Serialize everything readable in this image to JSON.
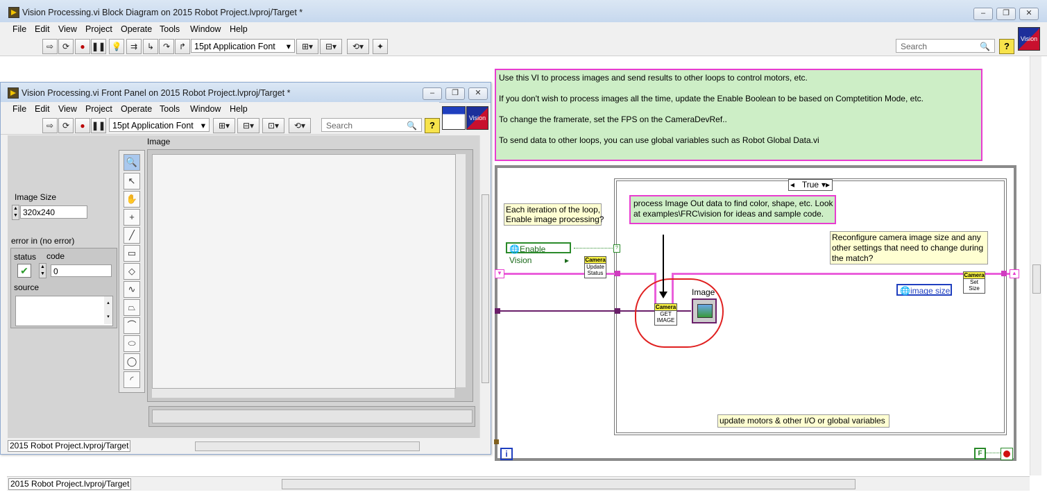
{
  "block_diagram": {
    "title": "Vision Processing.vi Block Diagram on 2015 Robot Project.lvproj/Target *",
    "menu": [
      "File",
      "Edit",
      "View",
      "Project",
      "Operate",
      "Tools",
      "Window",
      "Help"
    ],
    "font_select": "15pt Application Font",
    "search_placeholder": "Search",
    "help_icon": "?",
    "vision_badge": "Vision",
    "status_bar": "2015 Robot Project.lvproj/Target",
    "comment_lines": [
      "Use this VI to process images and send results to other loops to control motors, etc.",
      "If you don't wish to process images all the time, update the Enable Boolean to be based on Comptetition Mode, etc.",
      "To change the framerate, set the FPS on the CameraDevRef..",
      "To send data to other loops, you can use global variables such as Robot Global Data.vi"
    ],
    "case_selector": "True",
    "loop_note": [
      "Each iteration of the loop,",
      "Enable image processing?"
    ],
    "process_note": [
      "process Image Out data to find color, shape, etc.  Look",
      "at examples\\FRC\\vision for ideas and sample code."
    ],
    "reconfigure_note": [
      "Reconfigure camera image size and any",
      "other settings that need to change during",
      "the match?"
    ],
    "update_note": "update motors & other I/O or global variables",
    "enable_vision": "Enable Vision",
    "image_size_global": "image size",
    "node_update_status": [
      "Camera",
      "Update",
      "Status"
    ],
    "node_get_image": [
      "Camera",
      "GET",
      "IMAGE"
    ],
    "node_set_size": [
      "Camera",
      "Set",
      "Size"
    ],
    "image_indicator": "Image",
    "iteration_terminal": "i",
    "false_constant": "F"
  },
  "front_panel": {
    "title": "Vision Processing.vi Front Panel on 2015 Robot Project.lvproj/Target *",
    "menu": [
      "File",
      "Edit",
      "View",
      "Project",
      "Operate",
      "Tools",
      "Window",
      "Help"
    ],
    "font_select": "15pt Application Font",
    "search_placeholder": "Search",
    "help_icon": "?",
    "vision_badge": "Vision",
    "status_bar": "2015 Robot Project.lvproj/Target",
    "image_size_label": "Image Size",
    "image_size_value": "320x240",
    "error_cluster_label": "error in (no error)",
    "status_label": "status",
    "code_label": "code",
    "code_value": "0",
    "source_label": "source",
    "image_display_label": "Image"
  },
  "colors": {
    "comment_bg": "#cdeec6",
    "comment_border": "#e83cd0",
    "title_bg": "#c6d8ee",
    "note_bg": "#ffffd2",
    "loop_frame": "#8a8a8a"
  }
}
